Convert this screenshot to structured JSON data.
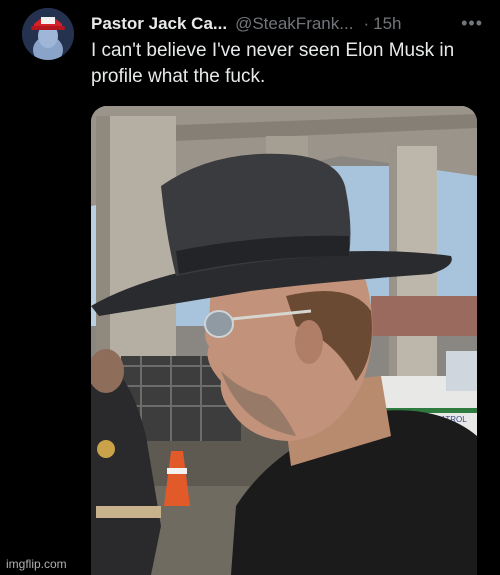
{
  "tweet": {
    "display_name": "Pastor Jack Ca...",
    "handle": "@SteakFrank...",
    "separator": "·",
    "time": "15h",
    "more_icon": "more-horizontal-icon",
    "text": "I can't believe I've never seen Elon Musk in profile what the fuck."
  },
  "media": {
    "vehicle_text": "RDER PATROL"
  },
  "watermark": {
    "text": "imgflip.com"
  }
}
